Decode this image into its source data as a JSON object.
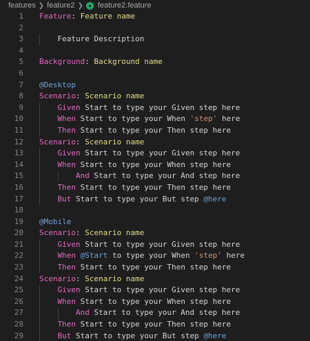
{
  "breadcrumb": {
    "items": [
      "features",
      "feature2",
      "feature2.feature"
    ]
  },
  "colors": {
    "background": "#1e1e1e",
    "keyword": "#e06bc0",
    "title": "#e3dd86",
    "text": "#d4d4d4",
    "tag": "#6fa3d8",
    "string": "#ce9178",
    "line_number": "#858585",
    "file_icon": "#23a566"
  },
  "icons": {
    "file": "gherkin-file-icon",
    "separator": "chevron-right-icon"
  },
  "lines": [
    {
      "n": "1",
      "indent": 0,
      "segs": [
        {
          "t": "Feature",
          "c": "kw"
        },
        {
          "t": ": ",
          "c": "punct"
        },
        {
          "t": "Feature name",
          "c": "title"
        }
      ]
    },
    {
      "n": "2",
      "indent": 0,
      "segs": []
    },
    {
      "n": "3",
      "indent": 4,
      "segs": [
        {
          "t": "Feature Description",
          "c": "plain"
        }
      ]
    },
    {
      "n": "4",
      "indent": 0,
      "segs": []
    },
    {
      "n": "5",
      "indent": 0,
      "segs": [
        {
          "t": "Background",
          "c": "kw"
        },
        {
          "t": ": ",
          "c": "punct"
        },
        {
          "t": "Background name",
          "c": "title"
        }
      ]
    },
    {
      "n": "6",
      "indent": 0,
      "segs": []
    },
    {
      "n": "7",
      "indent": 0,
      "segs": [
        {
          "t": "@Desktop",
          "c": "tag"
        }
      ]
    },
    {
      "n": "8",
      "indent": 0,
      "segs": [
        {
          "t": "Scenario",
          "c": "kw"
        },
        {
          "t": ": ",
          "c": "punct"
        },
        {
          "t": "Scenario name",
          "c": "title"
        }
      ]
    },
    {
      "n": "9",
      "indent": 4,
      "segs": [
        {
          "t": "Given",
          "c": "kw"
        },
        {
          "t": " Start to type your Given step here",
          "c": "plain"
        }
      ]
    },
    {
      "n": "10",
      "indent": 4,
      "segs": [
        {
          "t": "When",
          "c": "kw"
        },
        {
          "t": " Start to type your When ",
          "c": "plain"
        },
        {
          "t": "'step'",
          "c": "str"
        },
        {
          "t": " here",
          "c": "plain"
        }
      ]
    },
    {
      "n": "11",
      "indent": 4,
      "segs": [
        {
          "t": "Then",
          "c": "kw"
        },
        {
          "t": " Start to type your Then step here",
          "c": "plain"
        }
      ]
    },
    {
      "n": "12",
      "indent": 0,
      "segs": [
        {
          "t": "Scenario",
          "c": "kw"
        },
        {
          "t": ": ",
          "c": "punct"
        },
        {
          "t": "Scenario name",
          "c": "title"
        }
      ]
    },
    {
      "n": "13",
      "indent": 4,
      "segs": [
        {
          "t": "Given",
          "c": "kw"
        },
        {
          "t": " Start to type your Given step here",
          "c": "plain"
        }
      ]
    },
    {
      "n": "14",
      "indent": 4,
      "segs": [
        {
          "t": "When",
          "c": "kw"
        },
        {
          "t": " Start to type your When step here",
          "c": "plain"
        }
      ]
    },
    {
      "n": "15",
      "indent": 8,
      "segs": [
        {
          "t": "And",
          "c": "kw"
        },
        {
          "t": " Start to type your And step here",
          "c": "plain"
        }
      ]
    },
    {
      "n": "16",
      "indent": 4,
      "segs": [
        {
          "t": "Then",
          "c": "kw"
        },
        {
          "t": " Start to type your Then step here",
          "c": "plain"
        }
      ]
    },
    {
      "n": "17",
      "indent": 4,
      "segs": [
        {
          "t": "But",
          "c": "kw"
        },
        {
          "t": " Start to type your But step ",
          "c": "plain"
        },
        {
          "t": "@here",
          "c": "tag"
        }
      ]
    },
    {
      "n": "18",
      "indent": 0,
      "segs": []
    },
    {
      "n": "19",
      "indent": 0,
      "segs": [
        {
          "t": "@Mobile",
          "c": "tag"
        }
      ]
    },
    {
      "n": "20",
      "indent": 0,
      "segs": [
        {
          "t": "Scenario",
          "c": "kw"
        },
        {
          "t": ": ",
          "c": "punct"
        },
        {
          "t": "Scenario name",
          "c": "title"
        }
      ]
    },
    {
      "n": "21",
      "indent": 4,
      "segs": [
        {
          "t": "Given",
          "c": "kw"
        },
        {
          "t": " Start to type your Given step here",
          "c": "plain"
        }
      ]
    },
    {
      "n": "22",
      "indent": 4,
      "segs": [
        {
          "t": "When",
          "c": "kw"
        },
        {
          "t": " ",
          "c": "plain"
        },
        {
          "t": "@Start",
          "c": "tag"
        },
        {
          "t": " to type your When ",
          "c": "plain"
        },
        {
          "t": "'step'",
          "c": "str"
        },
        {
          "t": " here",
          "c": "plain"
        }
      ]
    },
    {
      "n": "23",
      "indent": 4,
      "segs": [
        {
          "t": "Then",
          "c": "kw"
        },
        {
          "t": " Start to type your Then step here",
          "c": "plain"
        }
      ]
    },
    {
      "n": "24",
      "indent": 0,
      "segs": [
        {
          "t": "Scenario",
          "c": "kw"
        },
        {
          "t": ": ",
          "c": "punct"
        },
        {
          "t": "Scenario name",
          "c": "title"
        }
      ]
    },
    {
      "n": "25",
      "indent": 4,
      "segs": [
        {
          "t": "Given",
          "c": "kw"
        },
        {
          "t": " Start to type your Given step here",
          "c": "plain"
        }
      ]
    },
    {
      "n": "26",
      "indent": 4,
      "segs": [
        {
          "t": "When",
          "c": "kw"
        },
        {
          "t": " Start to type your When step here",
          "c": "plain"
        }
      ]
    },
    {
      "n": "27",
      "indent": 8,
      "segs": [
        {
          "t": "And",
          "c": "kw"
        },
        {
          "t": " Start to type your And step here",
          "c": "plain"
        }
      ]
    },
    {
      "n": "28",
      "indent": 4,
      "segs": [
        {
          "t": "Then",
          "c": "kw"
        },
        {
          "t": " Start to type your Then step here",
          "c": "plain"
        }
      ]
    },
    {
      "n": "29",
      "indent": 4,
      "segs": [
        {
          "t": "But",
          "c": "kw"
        },
        {
          "t": " Start to type your But step ",
          "c": "plain"
        },
        {
          "t": "@here",
          "c": "tag"
        }
      ]
    }
  ]
}
